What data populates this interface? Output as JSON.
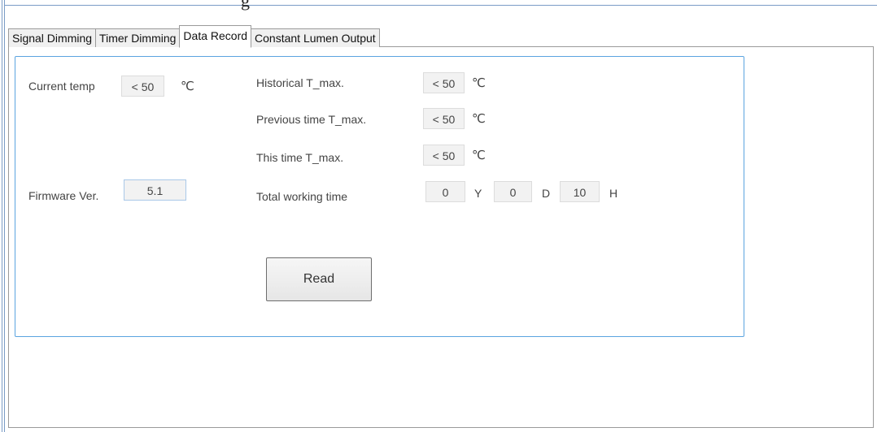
{
  "title_fragment": "g",
  "tabs": [
    {
      "label": "Signal Dimming",
      "active": false
    },
    {
      "label": "Timer Dimming",
      "active": false
    },
    {
      "label": "Data Record",
      "active": true
    },
    {
      "label": "Constant Lumen Output",
      "active": false
    }
  ],
  "data_record": {
    "current_temp": {
      "label": "Current temp",
      "value": "< 50",
      "unit": "℃"
    },
    "firmware": {
      "label": "Firmware Ver.",
      "value": "5.1"
    },
    "historical_tmax": {
      "label": "Historical T_max.",
      "value": "< 50",
      "unit": "℃"
    },
    "previous_tmax": {
      "label": "Previous time T_max.",
      "value": "< 50",
      "unit": "℃"
    },
    "this_tmax": {
      "label": "This time T_max.",
      "value": "< 50",
      "unit": "℃"
    },
    "total_working_time": {
      "label": "Total working time",
      "years": "0",
      "years_unit": "Y",
      "days": "0",
      "days_unit": "D",
      "hours": "10",
      "hours_unit": "H"
    },
    "read_button": "Read"
  },
  "colors": {
    "frame": "#7a9cc6",
    "group_border": "#5ba4e0",
    "field_bg": "#f2f2f2"
  }
}
